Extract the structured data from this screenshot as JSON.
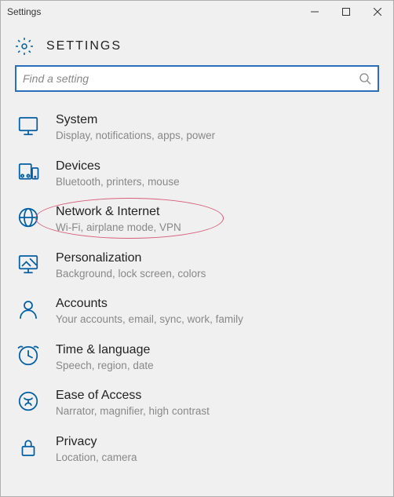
{
  "window": {
    "title": "Settings"
  },
  "header": {
    "title": "SETTINGS"
  },
  "search": {
    "placeholder": "Find a setting"
  },
  "categories": [
    {
      "icon": "system",
      "title": "System",
      "subtitle": "Display, notifications, apps, power",
      "highlighted": false
    },
    {
      "icon": "devices",
      "title": "Devices",
      "subtitle": "Bluetooth, printers, mouse",
      "highlighted": false
    },
    {
      "icon": "network",
      "title": "Network & Internet",
      "subtitle": "Wi-Fi, airplane mode, VPN",
      "highlighted": true
    },
    {
      "icon": "personalization",
      "title": "Personalization",
      "subtitle": "Background, lock screen, colors",
      "highlighted": false
    },
    {
      "icon": "accounts",
      "title": "Accounts",
      "subtitle": "Your accounts, email, sync, work, family",
      "highlighted": false
    },
    {
      "icon": "time",
      "title": "Time & language",
      "subtitle": "Speech, region, date",
      "highlighted": false
    },
    {
      "icon": "ease",
      "title": "Ease of Access",
      "subtitle": "Narrator, magnifier, high contrast",
      "highlighted": false
    },
    {
      "icon": "privacy",
      "title": "Privacy",
      "subtitle": "Location, camera",
      "highlighted": false
    }
  ]
}
